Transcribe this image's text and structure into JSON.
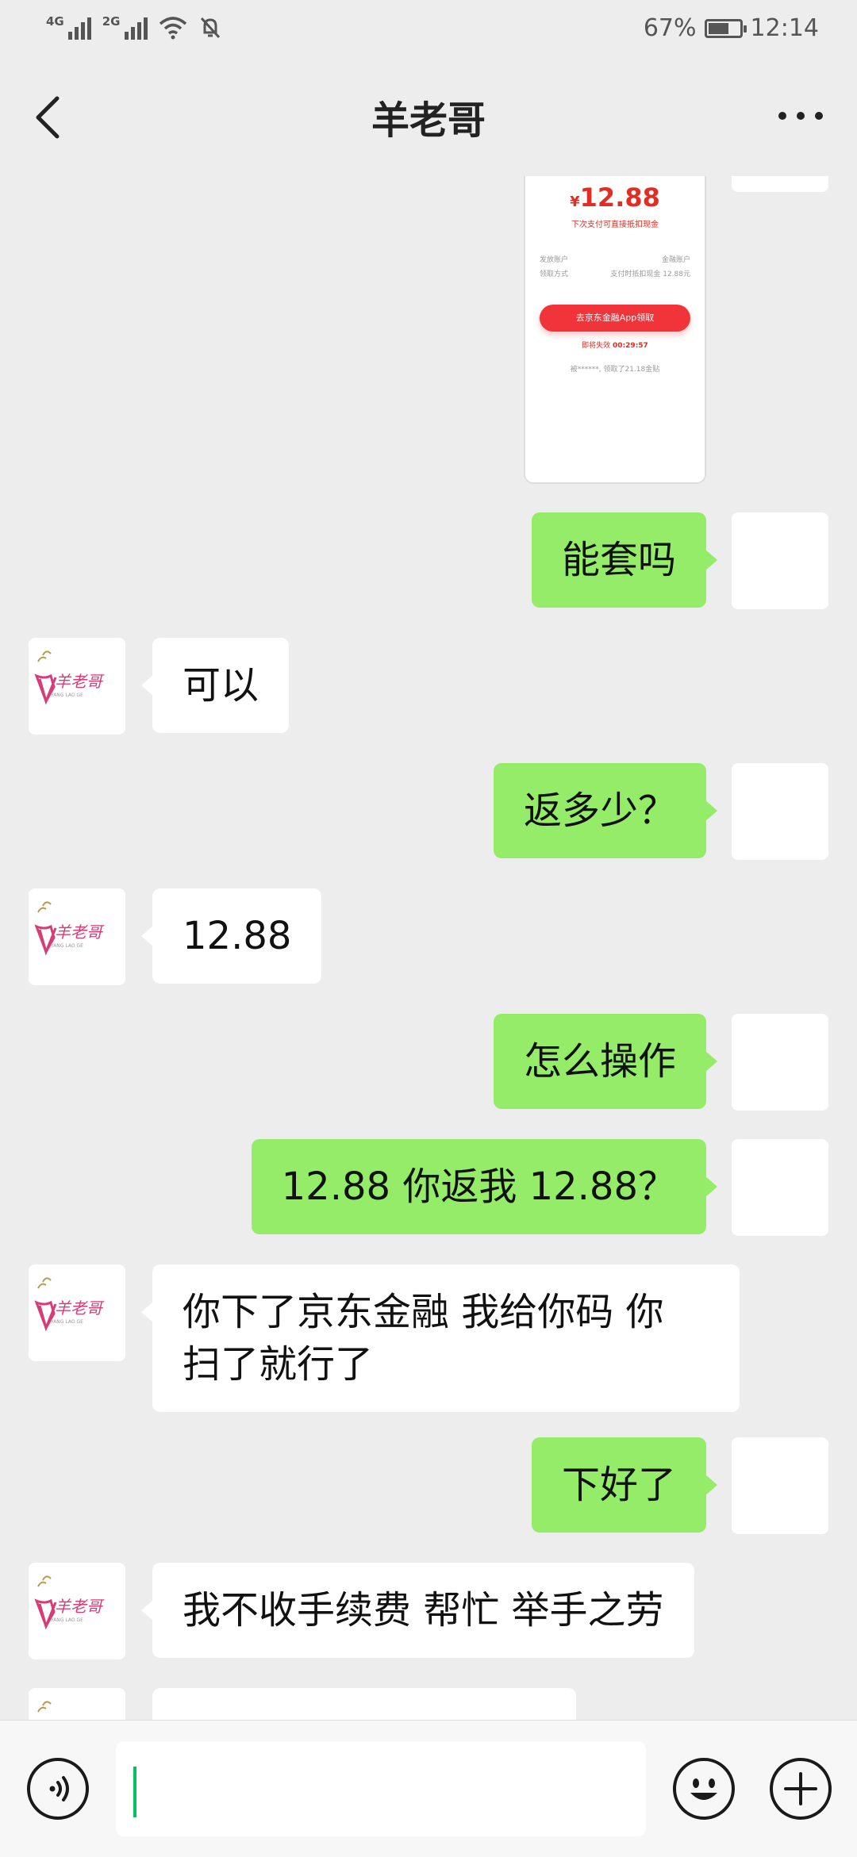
{
  "status_bar": {
    "network1": "4G",
    "network2": "2G",
    "battery": "67%",
    "battery_level": 0.67,
    "time": "12:14"
  },
  "header": {
    "title": "羊老哥"
  },
  "image_message": {
    "amount_symbol": "¥",
    "amount": "12.88",
    "hint": "下次支付可直接抵扣现金",
    "row1_label": "发放账户",
    "row1_value": "金融账户",
    "row2_label": "领取方式",
    "row2_value": "支付时抵扣现金 12.88元",
    "button": "去京东金融App领取",
    "timer_label": "即将失效",
    "timer_value": "00:29:57",
    "getter": "被******, 领取了21.18金贴"
  },
  "messages": [
    {
      "from": "self",
      "text": "能套吗"
    },
    {
      "from": "peer",
      "text": "可以"
    },
    {
      "from": "self",
      "text": "返多少？"
    },
    {
      "from": "peer",
      "text": "12.88"
    },
    {
      "from": "self",
      "text": "怎么操作"
    },
    {
      "from": "self",
      "text": "12.88 你返我 12.88？"
    },
    {
      "from": "peer",
      "line1": "你下了京东金融 我给你码 你",
      "line2": "扫了就行了"
    },
    {
      "from": "self",
      "text": "下好了"
    },
    {
      "from": "peer",
      "text": "我不收手续费 帮忙 举手之劳"
    }
  ],
  "peer_avatar": {
    "text": "羊老哥",
    "subtext": "YANG LAO GE",
    "color": "#d63c78"
  },
  "colors": {
    "self_bubble": "#95ec69",
    "peer_bubble": "#ffffff",
    "background": "#ededed",
    "caret": "#07c160"
  },
  "icons": [
    "back-icon",
    "more-icon",
    "voice-icon",
    "emoji-icon",
    "add-icon"
  ]
}
